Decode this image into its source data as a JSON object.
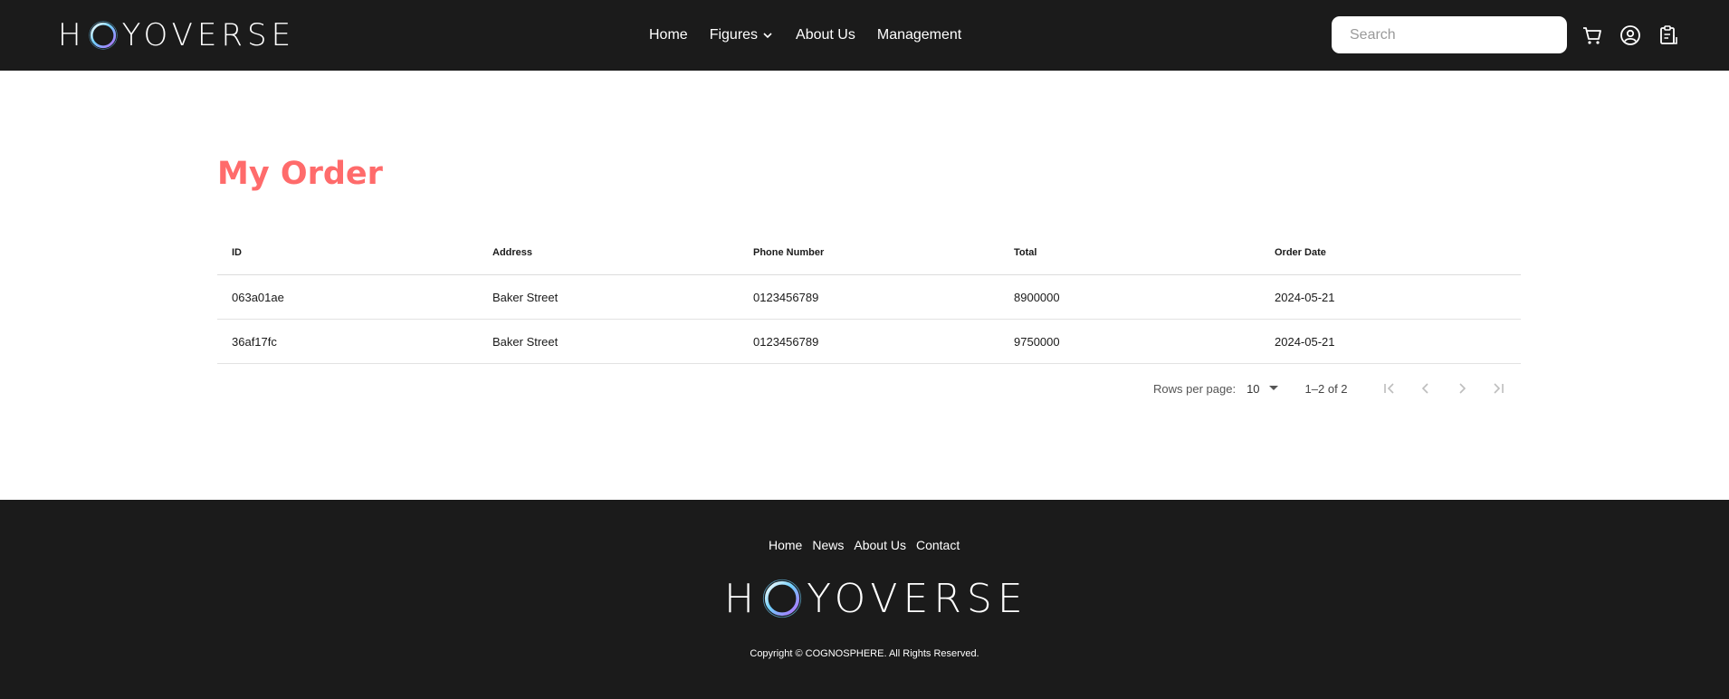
{
  "brand": {
    "logo_text": "HOYOVERSE"
  },
  "header": {
    "nav": [
      {
        "label": "Home"
      },
      {
        "label": "Figures",
        "has_dropdown": true
      },
      {
        "label": "About Us"
      },
      {
        "label": "Management"
      }
    ],
    "search": {
      "placeholder": "Search",
      "value": ""
    },
    "icons": [
      "cart-icon",
      "account-icon",
      "orders-icon"
    ]
  },
  "main": {
    "title": "My Order",
    "table": {
      "columns": [
        "ID",
        "Address",
        "Phone Number",
        "Total",
        "Order Date"
      ],
      "rows": [
        [
          "063a01ae",
          "Baker Street",
          "0123456789",
          "8900000",
          "2024-05-21"
        ],
        [
          "36af17fc",
          "Baker Street",
          "0123456789",
          "9750000",
          "2024-05-21"
        ]
      ]
    },
    "pagination": {
      "rows_per_page_label": "Rows per page:",
      "rows_per_page": "10",
      "range": "1–2 of 2"
    }
  },
  "footer": {
    "links": [
      "Home",
      "News",
      "About Us",
      "Contact"
    ],
    "copyright": "Copyright © COGNOSPHERE. All Rights Reserved."
  },
  "colors": {
    "header_bg": "#1b1b1b",
    "title_accent": "#ff6b6b",
    "logo_ring": "#6fd0ff"
  }
}
